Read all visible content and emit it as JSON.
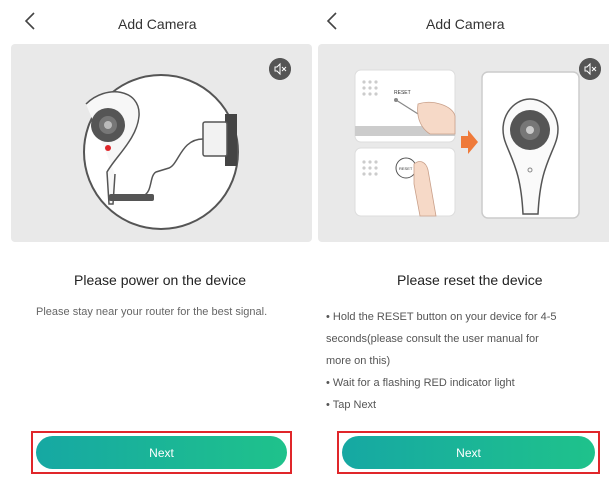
{
  "left": {
    "title": "Add Camera",
    "heading": "Please power on the device",
    "description": "Please stay near your router for the best signal.",
    "next_label": "Next"
  },
  "right": {
    "title": "Add Camera",
    "heading": "Please reset the device",
    "bullets": [
      "• Hold the RESET button on your device for 4-5",
      "seconds(please consult the user manual for",
      "more on this)",
      "• Wait for a flashing RED indicator light",
      "• Tap Next"
    ],
    "reset_label_top": "RESET",
    "reset_label_btn": "RESET",
    "next_label": "Next"
  },
  "colors": {
    "accent_start": "#16a8a3",
    "accent_end": "#1fc28b",
    "highlight_border": "#e0262a",
    "arrow": "#ef7a3a",
    "indicator": "#e0262a"
  },
  "icons": {
    "back": "chevron-left-icon",
    "mute": "speaker-mute-icon",
    "arrow": "arrow-right-icon"
  }
}
